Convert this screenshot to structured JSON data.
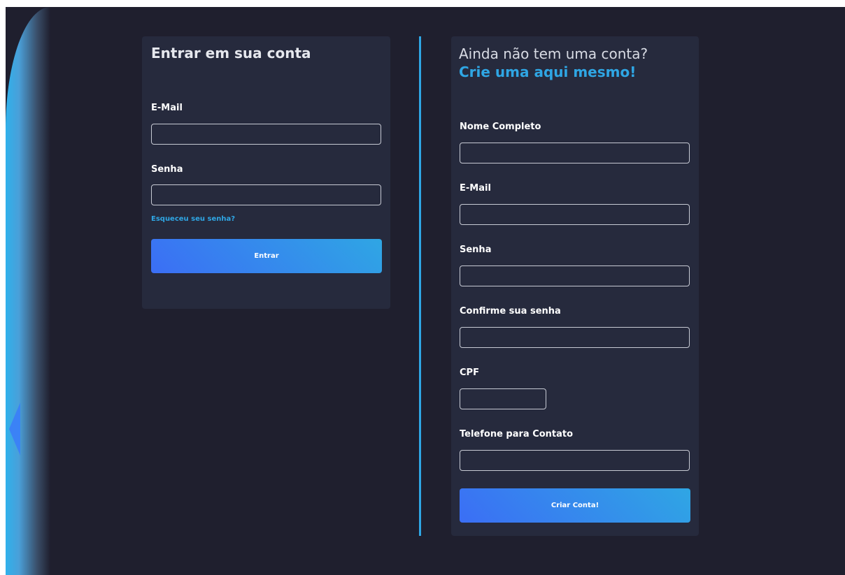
{
  "login": {
    "title": "Entrar em sua conta",
    "email_label": "E-Mail",
    "email_value": "",
    "password_label": "Senha",
    "password_value": "",
    "forgot_link": "Esqueceu seu senha?",
    "submit_label": "Entrar"
  },
  "signup": {
    "subtitle": "Ainda não tem uma conta?",
    "highlight": "Crie uma aqui mesmo!",
    "fields": [
      {
        "label": "Nome Completo",
        "value": ""
      },
      {
        "label": "E-Mail",
        "value": ""
      },
      {
        "label": "Senha",
        "value": ""
      },
      {
        "label": "Confirme sua senha",
        "value": ""
      },
      {
        "label": "CPF",
        "value": ""
      },
      {
        "label": "Telefone para Contato",
        "value": ""
      }
    ],
    "submit_label": "Criar Conta!"
  },
  "colors": {
    "background": "#1f1f2e",
    "card": "#262a3d",
    "accent": "#2fa6e4",
    "button_start": "#3b6ef5"
  }
}
